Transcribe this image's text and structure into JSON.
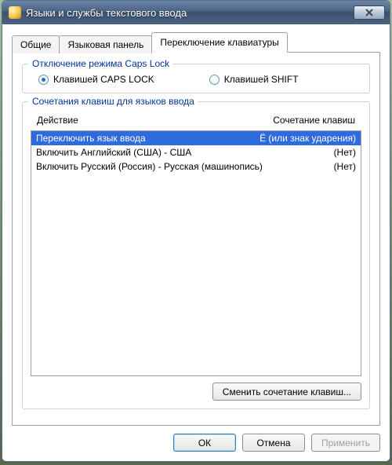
{
  "window": {
    "title": "Языки и службы текстового ввода"
  },
  "tabs": {
    "general": "Общие",
    "langbar": "Языковая панель",
    "switch": "Переключение клавиатуры"
  },
  "capslock_group": {
    "title": "Отключение режима Caps Lock",
    "by_capslock": "Клавишей CAPS LOCK",
    "by_shift": "Клавишей SHIFT",
    "selected": "by_capslock"
  },
  "hotkeys_group": {
    "title": "Сочетания клавиш для языков ввода",
    "col_action": "Действие",
    "col_shortcut": "Сочетание клавиш",
    "rows": [
      {
        "action": "Переключить язык ввода",
        "shortcut": "Ё (или знак ударения)",
        "selected": true
      },
      {
        "action": "Включить Английский (США) - США",
        "shortcut": "(Нет)",
        "selected": false
      },
      {
        "action": "Включить Русский (Россия) - Русская (машинопись)",
        "shortcut": "(Нет)",
        "selected": false
      }
    ],
    "change_btn": "Сменить сочетание клавиш..."
  },
  "buttons": {
    "ok": "ОК",
    "cancel": "Отмена",
    "apply": "Применить"
  }
}
